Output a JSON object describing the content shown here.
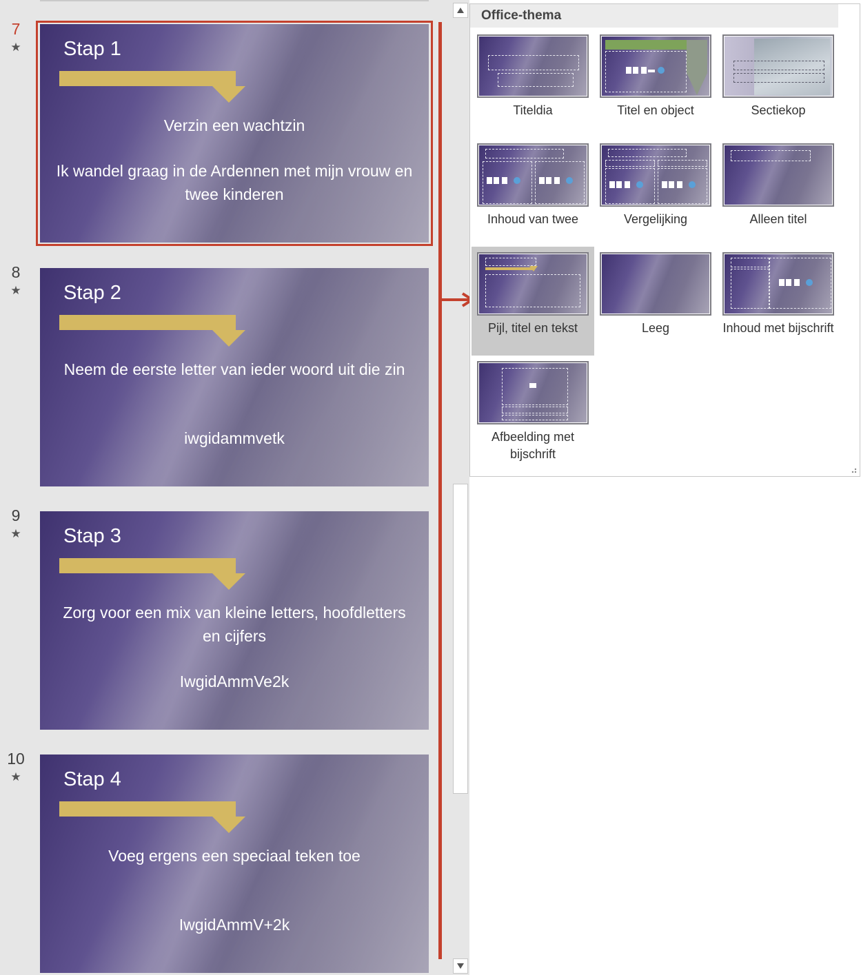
{
  "slides": [
    {
      "number": "7",
      "title": "Stap 1",
      "text": "Verzin een wachtzin",
      "code": "Ik wandel graag in de Ardennen met mijn vrouw en twee kinderen",
      "selected": true
    },
    {
      "number": "8",
      "title": "Stap 2",
      "text": "Neem de eerste letter van ieder woord uit die zin",
      "code": "iwgidammvetk",
      "selected": false
    },
    {
      "number": "9",
      "title": "Stap 3",
      "text": "Zorg voor een mix van kleine letters, hoofdletters en cijfers",
      "code": "IwgidAmmVe2k",
      "selected": false
    },
    {
      "number": "10",
      "title": "Stap 4",
      "text": "Voeg ergens een speciaal teken toe",
      "code": "IwgidAmmV+2k",
      "selected": false
    }
  ],
  "slide_star": "★",
  "gallery": {
    "header": "Office-thema",
    "layouts": [
      {
        "label": "Titeldia"
      },
      {
        "label": "Titel en object"
      },
      {
        "label": "Sectiekop"
      },
      {
        "label": "Inhoud van twee"
      },
      {
        "label": "Vergelijking"
      },
      {
        "label": "Alleen titel"
      },
      {
        "label": "Pijl, titel en tekst",
        "selected": true
      },
      {
        "label": "Leeg"
      },
      {
        "label": "Inhoud met bijschrift"
      },
      {
        "label": "Afbeelding met bijschrift"
      }
    ]
  },
  "colors": {
    "accent_red": "#c4412d",
    "arrow_gold": "#d4b862",
    "slide_purple": "#3f326f"
  },
  "icons": {
    "scroll_up": "triangle-up-icon",
    "scroll_down": "triangle-down-icon",
    "annotation_arrow": "arrow-right-icon",
    "slide_arrow": "bent-arrow-icon"
  }
}
